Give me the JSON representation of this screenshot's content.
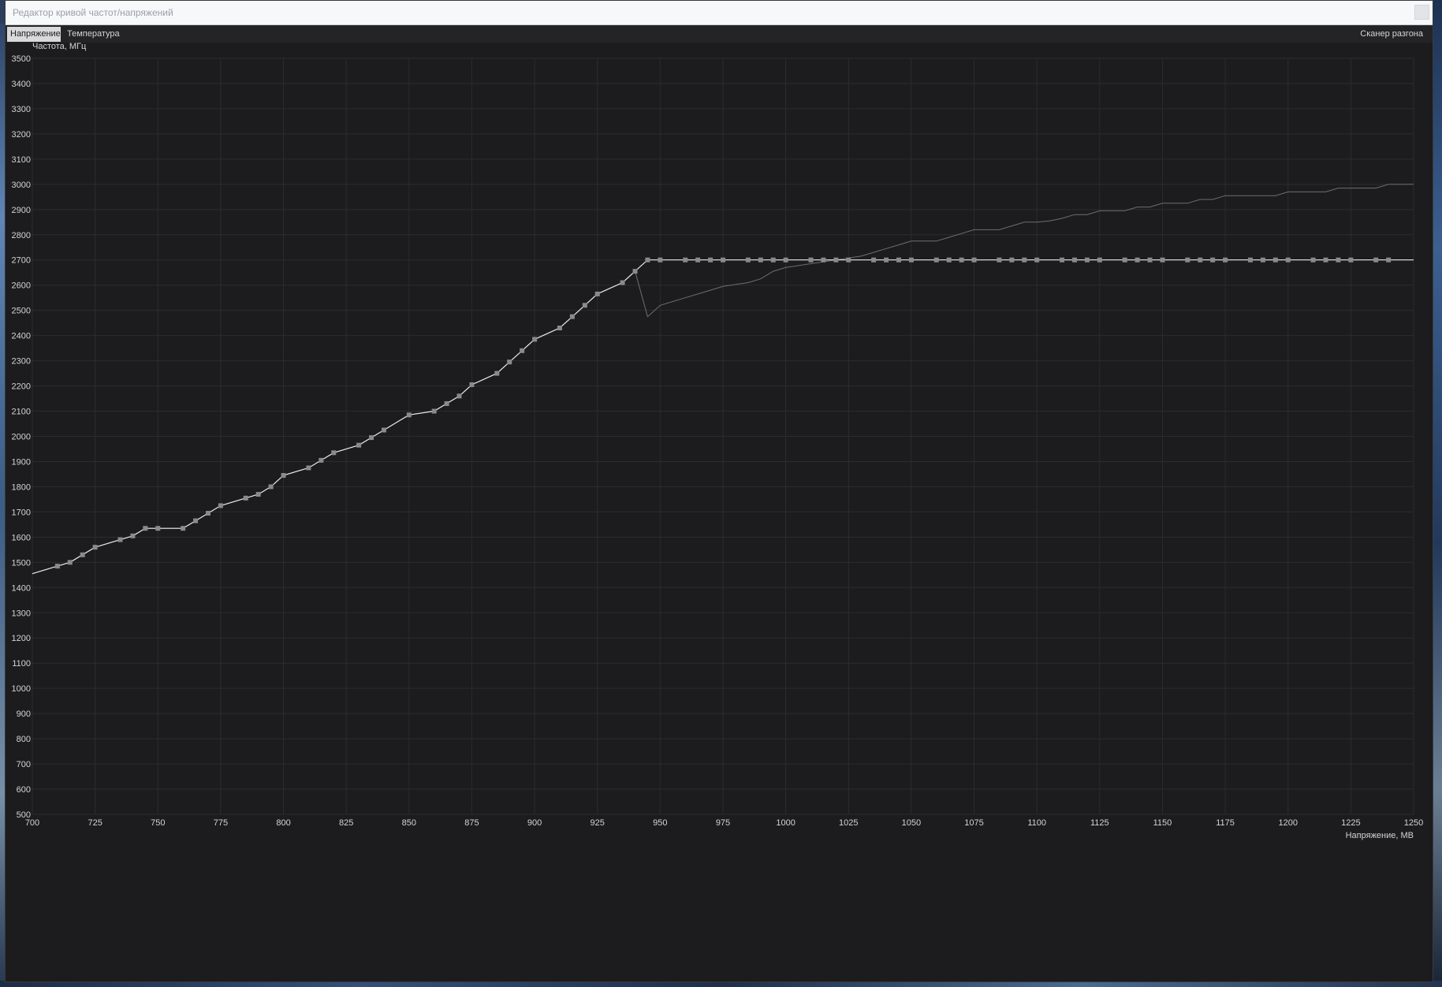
{
  "window": {
    "title": "Редактор кривой частот/напряжений"
  },
  "tabs": [
    {
      "label": "Напряжение",
      "active": true
    },
    {
      "label": "Температура",
      "active": false
    }
  ],
  "scanner_label": "Сканер разгона",
  "colors": {
    "background": "#1c1c1e",
    "grid": "#2c2c2e",
    "curve": "#e8e8e8",
    "marker": "#8a8a8a",
    "reference_curve": "#6e6e70"
  },
  "chart_data": {
    "type": "line",
    "title": "",
    "xlabel": "Напряжение, МВ",
    "ylabel": "Частота, МГц",
    "xlim": [
      700,
      1250
    ],
    "ylim": [
      500,
      3500
    ],
    "xticks": [
      700,
      725,
      750,
      775,
      800,
      825,
      850,
      875,
      900,
      925,
      950,
      975,
      1000,
      1025,
      1050,
      1075,
      1100,
      1125,
      1150,
      1175,
      1200,
      1225,
      1250
    ],
    "yticks": [
      500,
      600,
      700,
      800,
      900,
      1000,
      1100,
      1200,
      1300,
      1400,
      1500,
      1600,
      1700,
      1800,
      1900,
      2000,
      2100,
      2200,
      2300,
      2400,
      2500,
      2600,
      2700,
      2800,
      2900,
      3000,
      3100,
      3200,
      3300,
      3400,
      3500
    ],
    "grid": true,
    "series": [
      {
        "role": "curve",
        "markers": true,
        "x": [
          700,
          710,
          715,
          720,
          725,
          735,
          740,
          745,
          750,
          760,
          765,
          770,
          775,
          785,
          790,
          795,
          800,
          810,
          815,
          820,
          830,
          835,
          840,
          850,
          860,
          865,
          870,
          875,
          885,
          890,
          895,
          900,
          910,
          915,
          920,
          925,
          935,
          940,
          945,
          950,
          960,
          965,
          970,
          975,
          985,
          990,
          995,
          1000,
          1010,
          1015,
          1020,
          1025,
          1035,
          1040,
          1045,
          1050,
          1060,
          1065,
          1070,
          1075,
          1085,
          1090,
          1095,
          1100,
          1110,
          1115,
          1120,
          1125,
          1135,
          1140,
          1145,
          1150,
          1160,
          1165,
          1170,
          1175,
          1185,
          1190,
          1195,
          1200,
          1210,
          1215,
          1220,
          1225,
          1235,
          1240,
          1250
        ],
        "y": [
          1455,
          1485,
          1500,
          1530,
          1560,
          1590,
          1605,
          1635,
          1635,
          1635,
          1665,
          1695,
          1725,
          1755,
          1770,
          1800,
          1845,
          1875,
          1905,
          1935,
          1965,
          1995,
          2025,
          2085,
          2100,
          2130,
          2160,
          2205,
          2250,
          2295,
          2340,
          2385,
          2430,
          2475,
          2520,
          2565,
          2610,
          2655,
          2700,
          2700,
          2700,
          2700,
          2700,
          2700,
          2700,
          2700,
          2700,
          2700,
          2700,
          2700,
          2700,
          2700,
          2700,
          2700,
          2700,
          2700,
          2700,
          2700,
          2700,
          2700,
          2700,
          2700,
          2700,
          2700,
          2700,
          2700,
          2700,
          2700,
          2700,
          2700,
          2700,
          2700,
          2700,
          2700,
          2700,
          2700,
          2700,
          2700,
          2700,
          2700,
          2700,
          2700,
          2700,
          2700,
          2700,
          2700,
          2700
        ]
      },
      {
        "role": "reference",
        "markers": false,
        "x": [
          700,
          710,
          715,
          720,
          725,
          735,
          740,
          745,
          750,
          760,
          765,
          770,
          775,
          785,
          790,
          795,
          800,
          810,
          815,
          820,
          830,
          835,
          840,
          850,
          860,
          865,
          870,
          875,
          885,
          890,
          895,
          900,
          910,
          915,
          920,
          925,
          935,
          940,
          945,
          950,
          960,
          970,
          975,
          985,
          990,
          995,
          1000,
          1010,
          1020,
          1030,
          1035,
          1040,
          1045,
          1050,
          1060,
          1065,
          1070,
          1075,
          1085,
          1090,
          1095,
          1100,
          1105,
          1110,
          1115,
          1120,
          1125,
          1130,
          1135,
          1140,
          1145,
          1150,
          1160,
          1165,
          1170,
          1175,
          1185,
          1190,
          1195,
          1200,
          1210,
          1215,
          1220,
          1225,
          1235,
          1240,
          1250
        ],
        "y": [
          1455,
          1485,
          1500,
          1530,
          1560,
          1590,
          1605,
          1635,
          1635,
          1635,
          1665,
          1695,
          1725,
          1755,
          1770,
          1800,
          1845,
          1875,
          1905,
          1935,
          1965,
          1995,
          2025,
          2085,
          2100,
          2130,
          2160,
          2205,
          2250,
          2295,
          2340,
          2385,
          2430,
          2475,
          2520,
          2565,
          2610,
          2655,
          2475,
          2520,
          2550,
          2580,
          2595,
          2610,
          2625,
          2655,
          2670,
          2685,
          2700,
          2715,
          2730,
          2745,
          2760,
          2775,
          2775,
          2790,
          2805,
          2820,
          2820,
          2835,
          2850,
          2850,
          2855,
          2865,
          2880,
          2880,
          2895,
          2895,
          2895,
          2910,
          2910,
          2925,
          2925,
          2940,
          2940,
          2955,
          2955,
          2955,
          2955,
          2970,
          2970,
          2970,
          2985,
          2985,
          2985,
          3000,
          3000
        ]
      }
    ]
  }
}
